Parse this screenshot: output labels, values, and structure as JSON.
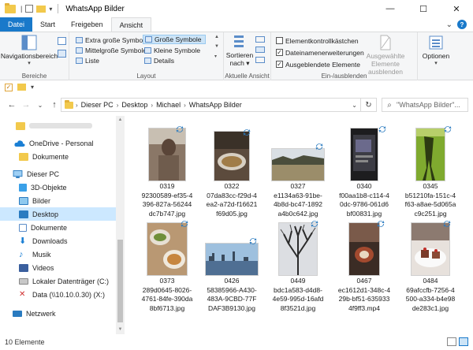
{
  "window": {
    "title": "WhatsApp Bilder",
    "minimize": "—",
    "maximize": "☐",
    "close": "✕"
  },
  "ribbon_tabs": [
    "Datei",
    "Start",
    "Freigeben",
    "Ansicht"
  ],
  "ribbon_right": {
    "collapse": "⌄",
    "help": "?"
  },
  "ribbon": {
    "bereiche": {
      "label": "Bereiche",
      "navigationsbereich": "Navigationsbereich"
    },
    "layout": {
      "label": "Layout",
      "options": [
        "Extra große Symbole",
        "Große Symbole",
        "Mittelgroße Symbole",
        "Kleine Symbole",
        "Liste",
        "Details"
      ],
      "selected": "Große Symbole"
    },
    "aktuelle_ansicht": {
      "label": "Aktuelle Ansicht",
      "sortieren": "Sortieren",
      "nach": "nach ▾"
    },
    "ein_ausblenden": {
      "label": "Ein-/ausblenden",
      "checkboxes": [
        {
          "label": "Elementkontrollkästchen",
          "checked": false
        },
        {
          "label": "Dateinamenerweiterungen",
          "checked": true
        },
        {
          "label": "Ausgeblendete Elemente",
          "checked": true
        }
      ],
      "hide_selected_line1": "Ausgewählte",
      "hide_selected_line2": "Elemente ausblenden"
    },
    "optionen": {
      "label": "Optionen"
    }
  },
  "address": {
    "back": "←",
    "forward": "→",
    "recent": "⌄",
    "up": "↑",
    "crumbs": [
      "Dieser PC",
      "Desktop",
      "Michael",
      "WhatsApp Bilder"
    ],
    "separator": "›",
    "dropdown": "⌄",
    "refresh": "↻",
    "search_placeholder": "\"WhatsApp Bilder\"..."
  },
  "nav_pane": {
    "items": [
      {
        "label": "",
        "icon": "folder-icon",
        "level": 1
      },
      {
        "label": "OneDrive - Personal",
        "icon": "cloud-icon",
        "level": 0
      },
      {
        "label": "Dokumente",
        "icon": "folder-icon",
        "level": 1
      },
      {
        "label": "Dieser PC",
        "icon": "pc-icon",
        "level": 0
      },
      {
        "label": "3D-Objekte",
        "icon": "cube-icon",
        "level": 1
      },
      {
        "label": "Bilder",
        "icon": "pictures-icon",
        "level": 1
      },
      {
        "label": "Desktop",
        "icon": "desktop-icon",
        "level": 1,
        "selected": true
      },
      {
        "label": "Dokumente",
        "icon": "documents-icon",
        "level": 1
      },
      {
        "label": "Downloads",
        "icon": "download-icon",
        "level": 1
      },
      {
        "label": "Musik",
        "icon": "music-icon",
        "level": 1
      },
      {
        "label": "Videos",
        "icon": "video-icon",
        "level": 1
      },
      {
        "label": "Lokaler Datenträger (C:)",
        "icon": "drive-icon",
        "level": 1
      },
      {
        "label": "Data (\\\\10.10.0.30) (X:)",
        "icon": "network-drive-icon",
        "level": 1
      },
      {
        "label": "Netzwerk",
        "icon": "network-icon",
        "level": 0
      }
    ]
  },
  "files": [
    {
      "name": "0319 92300589-ef35-4396-827a-56244dc7b747.jpg",
      "line1": "0319",
      "line2": "92300589-ef35-4",
      "line3": "396-827a-56244",
      "line4": "dc7b747.jpg",
      "thumb": "portrait-person",
      "sync": "synced"
    },
    {
      "name": "0322 07da83cc-f29d-4ea2-a72d-f16621f69d05.jpg",
      "line1": "0322",
      "line2": "07da83cc-f29d-4",
      "line3": "ea2-a72d-f16621",
      "line4": "f69d05.jpg",
      "thumb": "food-plate",
      "sync": "synced"
    },
    {
      "name": "0327 e1134a63-91be-4b8d-bc47-1892a4b0c642.jpg",
      "line1": "0327",
      "line2": "e1134a63-91be-",
      "line3": "4b8d-bc47-1892",
      "line4": "a4b0c642.jpg",
      "thumb": "landscape-field",
      "sync": "synced"
    },
    {
      "name": "0340 f00aa1b8-c114-40dc-9786-061d6bf00831.jpg",
      "line1": "0340",
      "line2": "f00aa1b8-c114-4",
      "line3": "0dc-9786-061d6",
      "line4": "bf00831.jpg",
      "thumb": "phone-screen",
      "sync": "synced"
    },
    {
      "name": "0345 b51210fa-151c-4f63-a8ae-5d065ac9c251.jpg",
      "line1": "0345",
      "line2": "b51210fa-151c-4",
      "line3": "f63-a8ae-5d065a",
      "line4": "c9c251.jpg",
      "thumb": "shadow-grass",
      "sync": "synced"
    },
    {
      "name": "0373 289d0645-8026-4761-84fe-390da8bf6713.jpg",
      "line1": "0373",
      "line2": "289d0645-8026-",
      "line3": "4761-84fe-390da",
      "line4": "8bf6713.jpg",
      "thumb": "food-table",
      "sync": "synced"
    },
    {
      "name": "0426 58385966-A430-483A-9CBD-77FDAF3B9130.jpg",
      "line1": "0426",
      "line2": "58385966-A430-",
      "line3": "483A-9CBD-77F",
      "line4": "DAF3B9130.jpg",
      "thumb": "city-skyline",
      "sync": "synced"
    },
    {
      "name": "0449 bdc1a583-d4d8-4e59-995d-16afd8f3521d.jpg",
      "line1": "0449",
      "line2": "bdc1a583-d4d8-",
      "line3": "4e59-995d-16afd",
      "line4": "8f3521d.jpg",
      "thumb": "bare-tree",
      "sync": "synced"
    },
    {
      "name": "0467 ec1612d1-348c-429b-bf51-6359334f9ff3.mp4",
      "line1": "0467",
      "line2": "ec1612d1-348c-4",
      "line3": "29b-bf51-635933",
      "line4": "4f9ff3.mp4",
      "thumb": "video-dark",
      "sync": "synced"
    },
    {
      "name": "0484 69afccfb-7256-4500-a334-b4e98de283c1.jpg",
      "line1": "0484",
      "line2": "69afccfb-7256-4",
      "line3": "500-a334-b4e98",
      "line4": "de283c1.jpg",
      "thumb": "cake-plate",
      "sync": "synced"
    }
  ],
  "status": {
    "count": "10 Elemente"
  }
}
